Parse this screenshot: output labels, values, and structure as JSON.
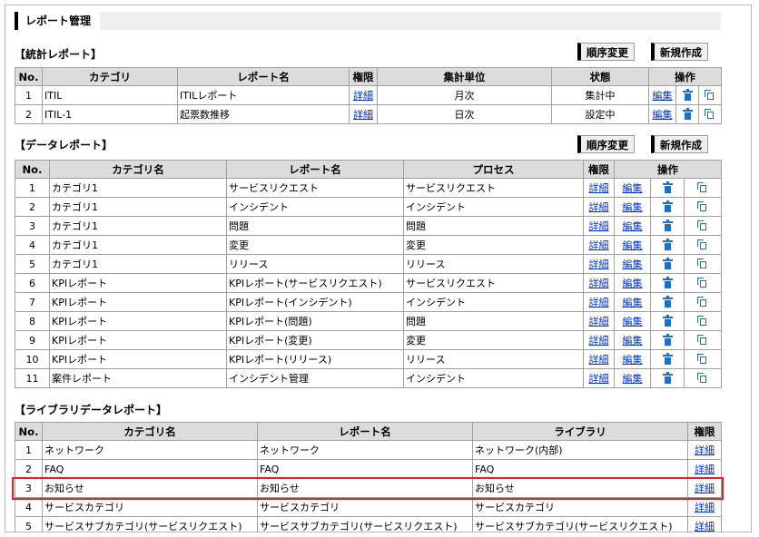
{
  "header": {
    "title": "レポート管理"
  },
  "stats_section": {
    "title": "【統計レポート】",
    "reorder_label": "順序変更",
    "new_label": "新規作成",
    "columns": [
      "No.",
      "カテゴリ",
      "レポート名",
      "権限",
      "集計単位",
      "状態",
      "操作"
    ],
    "rows": [
      {
        "no": "1",
        "category": "ITIL",
        "name": "ITILレポート",
        "perm": "詳細",
        "unit": "月次",
        "status": "集計中",
        "edit": "編集"
      },
      {
        "no": "2",
        "category": "ITIL-1",
        "name": "起票数推移",
        "perm": "詳細",
        "unit": "日次",
        "status": "設定中",
        "edit": "編集"
      }
    ]
  },
  "data_section": {
    "title": "【データレポート】",
    "reorder_label": "順序変更",
    "new_label": "新規作成",
    "columns": [
      "No.",
      "カテゴリ名",
      "レポート名",
      "プロセス",
      "権限",
      "操作"
    ],
    "rows": [
      {
        "no": "1",
        "category": "カテゴリ1",
        "name": "サービスリクエスト",
        "process": "サービスリクエスト",
        "perm": "詳細",
        "edit": "編集"
      },
      {
        "no": "2",
        "category": "カテゴリ1",
        "name": "インシデント",
        "process": "インシデント",
        "perm": "詳細",
        "edit": "編集"
      },
      {
        "no": "3",
        "category": "カテゴリ1",
        "name": "問題",
        "process": "問題",
        "perm": "詳細",
        "edit": "編集"
      },
      {
        "no": "4",
        "category": "カテゴリ1",
        "name": "変更",
        "process": "変更",
        "perm": "詳細",
        "edit": "編集"
      },
      {
        "no": "5",
        "category": "カテゴリ1",
        "name": "リリース",
        "process": "リリース",
        "perm": "詳細",
        "edit": "編集"
      },
      {
        "no": "6",
        "category": "KPIレポート",
        "name": "KPIレポート(サービスリクエスト)",
        "process": "サービスリクエスト",
        "perm": "詳細",
        "edit": "編集"
      },
      {
        "no": "7",
        "category": "KPIレポート",
        "name": "KPIレポート(インシデント)",
        "process": "インシデント",
        "perm": "詳細",
        "edit": "編集"
      },
      {
        "no": "8",
        "category": "KPIレポート",
        "name": "KPIレポート(問題)",
        "process": "問題",
        "perm": "詳細",
        "edit": "編集"
      },
      {
        "no": "9",
        "category": "KPIレポート",
        "name": "KPIレポート(変更)",
        "process": "変更",
        "perm": "詳細",
        "edit": "編集"
      },
      {
        "no": "10",
        "category": "KPIレポート",
        "name": "KPIレポート(リリース)",
        "process": "リリース",
        "perm": "詳細",
        "edit": "編集"
      },
      {
        "no": "11",
        "category": "案件レポート",
        "name": "インシデント管理",
        "process": "インシデント",
        "perm": "詳細",
        "edit": "編集"
      }
    ]
  },
  "library_section": {
    "title": "【ライブラリデータレポート】",
    "columns": [
      "No.",
      "カテゴリ名",
      "レポート名",
      "ライブラリ",
      "権限"
    ],
    "rows": [
      {
        "no": "1",
        "category": "ネットワーク",
        "name": "ネットワーク",
        "library": "ネットワーク(内部)",
        "perm": "詳細"
      },
      {
        "no": "2",
        "category": "FAQ",
        "name": "FAQ",
        "library": "FAQ",
        "perm": "詳細"
      },
      {
        "no": "3",
        "category": "お知らせ",
        "name": "お知らせ",
        "library": "お知らせ",
        "perm": "詳細"
      },
      {
        "no": "4",
        "category": "サービスカテゴリ",
        "name": "サービスカテゴリ",
        "library": "サービスカテゴリ",
        "perm": "詳細"
      },
      {
        "no": "5",
        "category": "サービスサブカテゴリ(サービスリクエスト)",
        "name": "サービスサブカテゴリ(サービスリクエスト)",
        "library": "サービスサブカテゴリ(サービスリクエスト)",
        "perm": "詳細"
      }
    ]
  },
  "icons": {
    "delete": "trash-icon",
    "copy": "copy-icon"
  },
  "colors": {
    "link": "#0033cc",
    "icon": "#1f6fc4",
    "header_bg": "#dcdcdc",
    "highlight": "#e0202c"
  }
}
